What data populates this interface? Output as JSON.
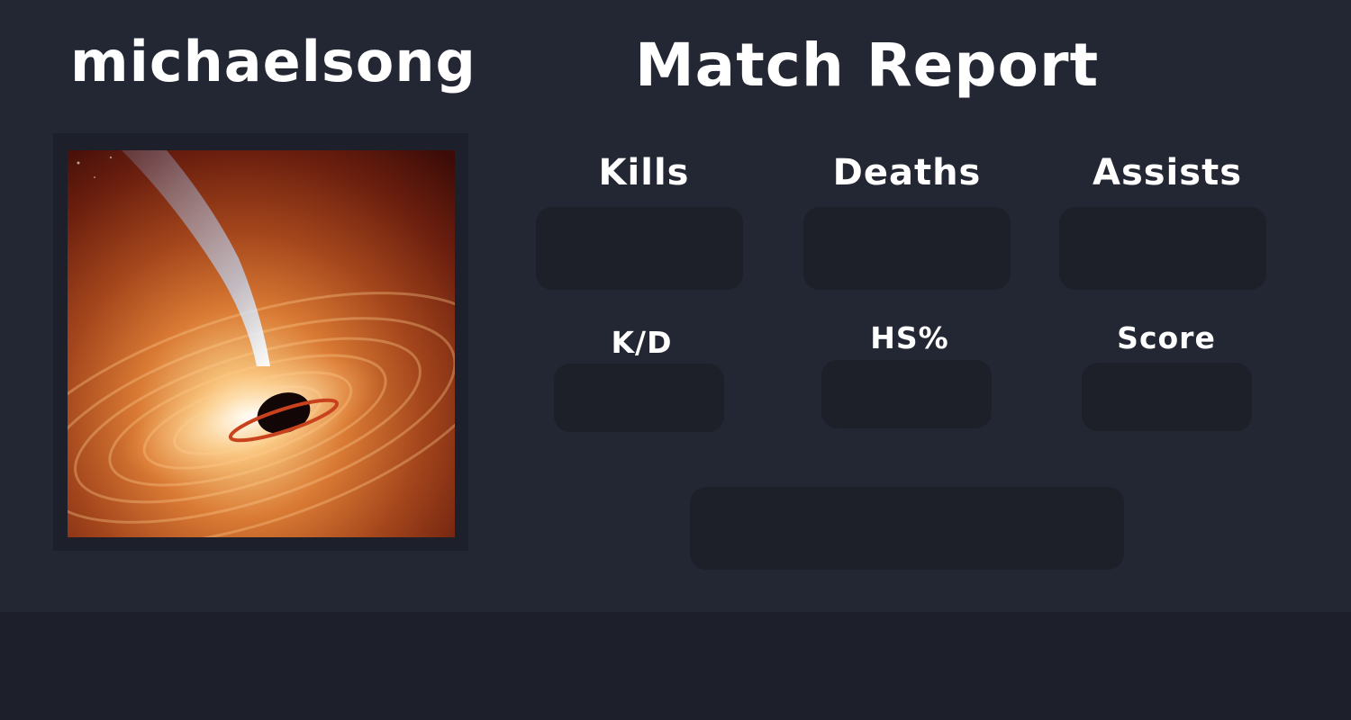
{
  "player": {
    "username": "michaelsong",
    "avatar_icon": "black-hole-image"
  },
  "header": {
    "title": "Match Report"
  },
  "stats": {
    "kills": {
      "label": "Kills",
      "value": ""
    },
    "deaths": {
      "label": "Deaths",
      "value": ""
    },
    "assists": {
      "label": "Assists",
      "value": ""
    },
    "kd": {
      "label": "K/D",
      "value": ""
    },
    "hs_percent": {
      "label": "HS%",
      "value": ""
    },
    "score": {
      "label": "Score",
      "value": ""
    }
  },
  "summary": {
    "value": ""
  },
  "colors": {
    "background": "#232633",
    "panel": "#1d1f29",
    "text": "#ffffff"
  }
}
